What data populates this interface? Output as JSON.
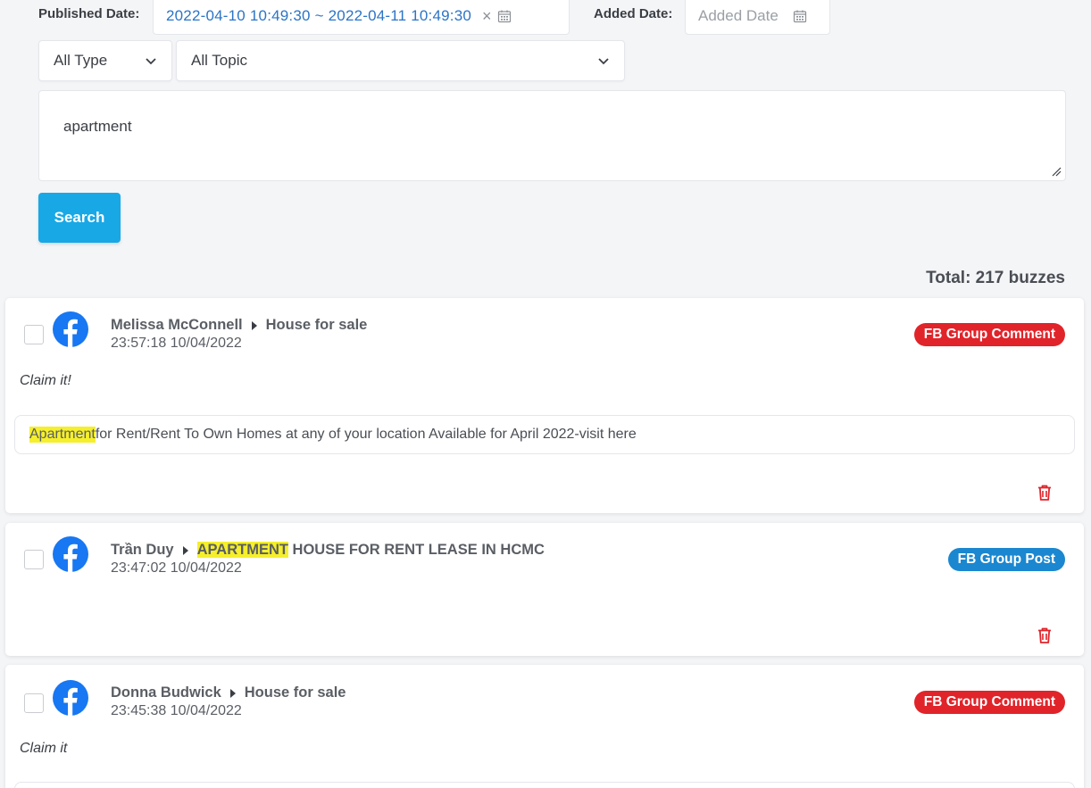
{
  "filters": {
    "published_label": "Published Date:",
    "published_value": "2022-04-10 10:49:30 ~ 2022-04-11 10:49:30",
    "added_label": "Added Date:",
    "added_placeholder": "Added Date",
    "type_value": "All Type",
    "topic_value": "All Topic",
    "keyword_value": "apartment",
    "search_label": "Search"
  },
  "total_text": "Total: 217 buzzes",
  "colors": {
    "accent": "#18a8e6",
    "badge_comment": "#e0242a",
    "badge_post": "#1b87d0",
    "facebook": "#1877f2",
    "highlight": "#f5ef2c",
    "delete": "#e0242a"
  },
  "buzzes": [
    {
      "author": "Melissa McConnell",
      "target": "House for sale",
      "timestamp": "23:57:18 10/04/2022",
      "badge": "FB Group Comment",
      "comment": "Claim it!",
      "quote_highlight": "Apartment",
      "quote_rest": " for Rent/Rent To Own Homes at any of your location Available for April 2022-visit here"
    },
    {
      "author": "Trần Duy",
      "target_highlight": "APARTMENT",
      "target_rest": " HOUSE FOR RENT LEASE IN HCMC",
      "timestamp": "23:47:02 10/04/2022",
      "badge": "FB Group Post"
    },
    {
      "author": "Donna Budwick",
      "target": "House for sale",
      "timestamp": "23:45:38 10/04/2022",
      "badge": "FB Group Comment",
      "comment": "Claim it"
    }
  ]
}
